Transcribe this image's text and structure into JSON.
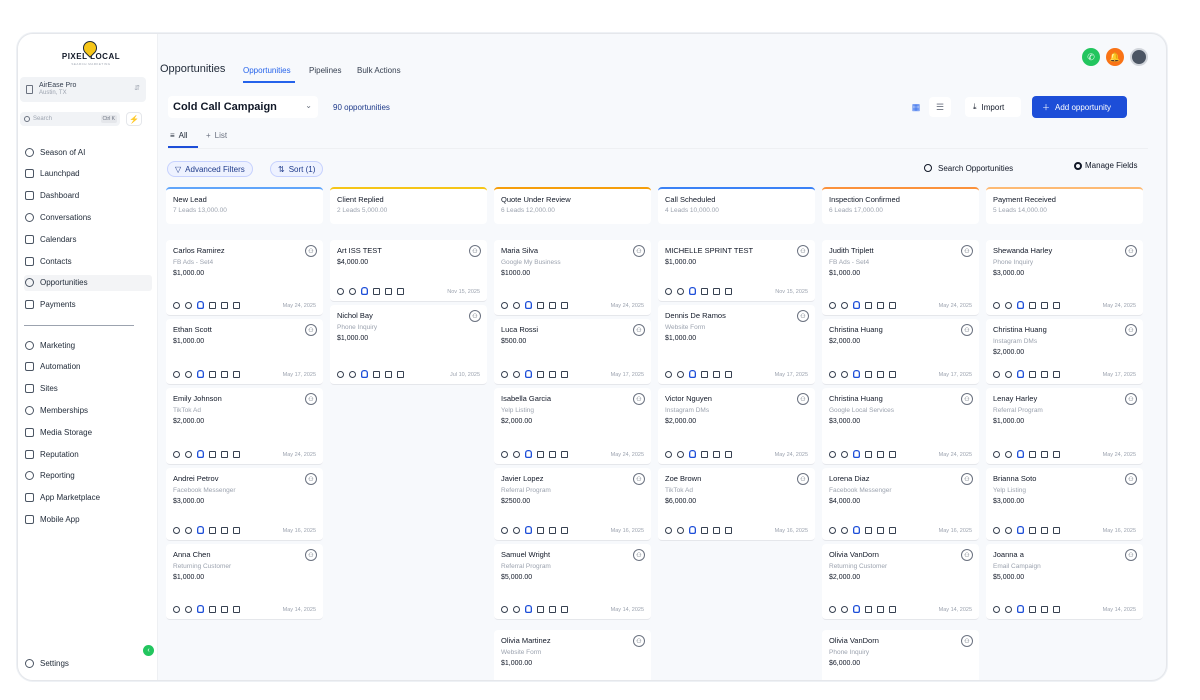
{
  "brand": {
    "name": "PIXEL LOCAL",
    "tagline": "SEARCH MARKETING"
  },
  "account": {
    "name": "AirEase Pro",
    "location": "Austin, TX"
  },
  "sidebar": {
    "search_placeholder": "Search",
    "search_shortcut": "Ctrl K",
    "items": [
      {
        "label": "Season of AI",
        "icon": "sparkle-icon"
      },
      {
        "label": "Launchpad",
        "icon": "rocket-icon"
      },
      {
        "label": "Dashboard",
        "icon": "dashboard-icon"
      },
      {
        "label": "Conversations",
        "icon": "chat-icon"
      },
      {
        "label": "Calendars",
        "icon": "calendar-icon"
      },
      {
        "label": "Contacts",
        "icon": "contacts-icon"
      },
      {
        "label": "Opportunities",
        "icon": "opportunities-icon"
      },
      {
        "label": "Payments",
        "icon": "payments-icon"
      }
    ],
    "items2": [
      {
        "label": "Marketing",
        "icon": "megaphone-icon"
      },
      {
        "label": "Automation",
        "icon": "automation-icon"
      },
      {
        "label": "Sites",
        "icon": "globe-icon"
      },
      {
        "label": "Memberships",
        "icon": "membership-icon"
      },
      {
        "label": "Media Storage",
        "icon": "media-icon"
      },
      {
        "label": "Reputation",
        "icon": "star-icon"
      },
      {
        "label": "Reporting",
        "icon": "chart-icon"
      },
      {
        "label": "App Marketplace",
        "icon": "grid-icon"
      },
      {
        "label": "Mobile App",
        "icon": "phone-icon"
      }
    ],
    "settings": "Settings"
  },
  "header": {
    "title": "Opportunities",
    "tabs": [
      "Opportunities",
      "Pipelines",
      "Bulk Actions"
    ]
  },
  "toolbar": {
    "pipeline": "Cold Call Campaign",
    "count": "90 opportunities",
    "import": "Import",
    "add": "Add opportunity"
  },
  "views": {
    "all": "All",
    "list": "List"
  },
  "filters": {
    "advanced": "Advanced Filters",
    "sort": "Sort (1)",
    "search": "Search Opportunities",
    "manage": "Manage Fields"
  },
  "colors": {
    "accent": "#1d4ed8",
    "call": "#22c55e",
    "notify": "#f97316"
  },
  "columns": [
    {
      "name": "New Lead",
      "meta": "7 Leads 13,000.00",
      "accent": "#60a5fa",
      "cards": [
        {
          "name": "Carlos Ramirez",
          "source": "FB Ads - Set4",
          "value": "$1,000.00",
          "date": "May 24, 2025"
        },
        {
          "name": "Ethan Scott",
          "source": "",
          "value": "$1,000.00",
          "date": "May 17, 2025"
        },
        {
          "name": "Emily Johnson",
          "source": "TikTok Ad",
          "value": "$2,000.00",
          "date": "May 24, 2025"
        },
        {
          "name": "Andrei Petrov",
          "source": "Facebook Messenger",
          "value": "$3,000.00",
          "date": "May 16, 2025"
        },
        {
          "name": "Anna Chen",
          "source": "Returning Customer",
          "value": "$1,000.00",
          "date": "May 14, 2025"
        }
      ]
    },
    {
      "name": "Client Replied",
      "meta": "2 Leads 5,000.00",
      "accent": "#f5c518",
      "cards": [
        {
          "name": "Art ISS TEST",
          "source": "",
          "value": "$4,000.00",
          "date": "Nov 15, 2025"
        },
        {
          "name": "Nichol Bay",
          "source": "Phone Inquiry",
          "value": "$1,000.00",
          "date": "Jul 10, 2025"
        }
      ]
    },
    {
      "name": "Quote Under Review",
      "meta": "6 Leads 12,000.00",
      "accent": "#f59e0b",
      "cards": [
        {
          "name": "Maria Silva",
          "source": "Google My Business",
          "value": "$1000.00",
          "date": "May 24, 2025"
        },
        {
          "name": "Luca Rossi",
          "source": "",
          "value": "$500.00",
          "date": "May 17, 2025"
        },
        {
          "name": "Isabella Garcia",
          "source": "Yelp Listing",
          "value": "$2,000.00",
          "date": "May 24, 2025"
        },
        {
          "name": "Javier Lopez",
          "source": "Referral Program",
          "value": "$2500.00",
          "date": "May 16, 2025"
        },
        {
          "name": "Samuel Wright",
          "source": "Referral Program",
          "value": "$5,000.00",
          "date": "May 14, 2025"
        },
        {
          "name": "Olivia Martinez",
          "source": "Website Form",
          "value": "$1,000.00",
          "date": ""
        }
      ]
    },
    {
      "name": "Call Scheduled",
      "meta": "4 Leads 10,000.00",
      "accent": "#3b82f6",
      "cards": [
        {
          "name": "MICHELLE SPRINT TEST",
          "source": "",
          "value": "$1,000.00",
          "date": "Nov 15, 2025"
        },
        {
          "name": "Dennis De Ramos",
          "source": "Website Form",
          "value": "$1,000.00",
          "date": "May 17, 2025"
        },
        {
          "name": "Victor Nguyen",
          "source": "Instagram DMs",
          "value": "$2,000.00",
          "date": "May 24, 2025"
        },
        {
          "name": "Zoe Brown",
          "source": "TikTok Ad",
          "value": "$6,000.00",
          "date": "May 16, 2025"
        }
      ]
    },
    {
      "name": "Inspection Confirmed",
      "meta": "6 Leads 17,000.00",
      "accent": "#fb923c",
      "cards": [
        {
          "name": "Judith Triplett",
          "source": "FB Ads - Set4",
          "value": "$1,000.00",
          "date": "May 24, 2025"
        },
        {
          "name": "Christina Huang",
          "source": "",
          "value": "$2,000.00",
          "date": "May 17, 2025"
        },
        {
          "name": "Christina Huang",
          "source": "Google Local Services",
          "value": "$3,000.00",
          "date": "May 24, 2025"
        },
        {
          "name": "Lorena Diaz",
          "source": "Facebook Messenger",
          "value": "$4,000.00",
          "date": "May 16, 2025"
        },
        {
          "name": "Olivia VanDorn",
          "source": "Returning Customer",
          "value": "$2,000.00",
          "date": "May 14, 2025"
        },
        {
          "name": "Olivia VanDorn",
          "source": "Phone Inquiry",
          "value": "$6,000.00",
          "date": ""
        }
      ]
    },
    {
      "name": "Payment Received",
      "meta": "5 Leads 14,000.00",
      "accent": "#fdba74",
      "cards": [
        {
          "name": "Shewanda Harley",
          "source": "Phone Inquiry",
          "value": "$3,000.00",
          "date": "May 24, 2025"
        },
        {
          "name": "Christina Huang",
          "source": "Instagram DMs",
          "value": "$2,000.00",
          "date": "May 17, 2025"
        },
        {
          "name": "Lenay Harley",
          "source": "Referral Program",
          "value": "$1,000.00",
          "date": "May 24, 2025"
        },
        {
          "name": "Brianna Soto",
          "source": "Yelp Listing",
          "value": "$3,000.00",
          "date": "May 16, 2025"
        },
        {
          "name": "Joanna a",
          "source": "Email Campaign",
          "value": "$5,000.00",
          "date": "May 14, 2025"
        }
      ]
    }
  ]
}
